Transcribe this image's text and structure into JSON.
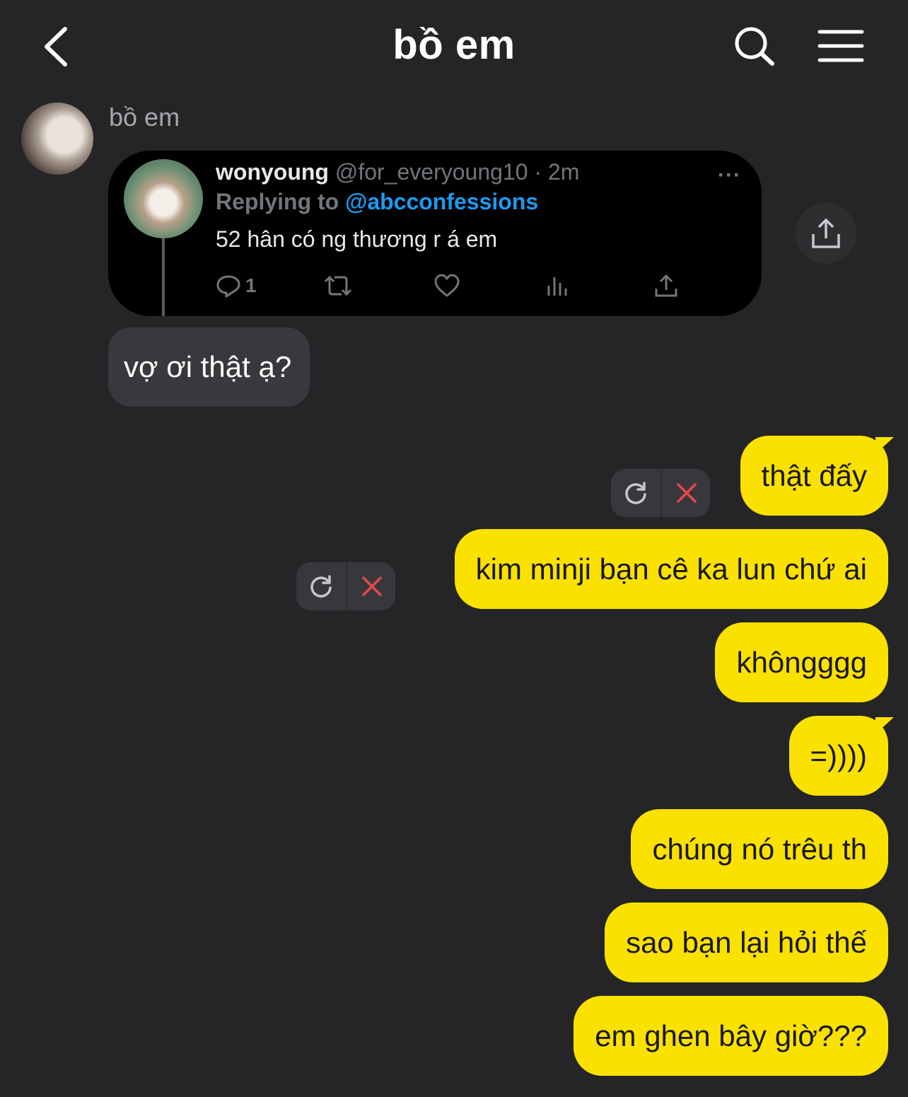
{
  "header": {
    "title": "bồ em",
    "back_icon": "chevron-left-icon",
    "search_icon": "search-icon",
    "menu_icon": "hamburger-menu-icon"
  },
  "incoming": {
    "sender_name": "bồ em",
    "tweet": {
      "display_name": "wonyoung",
      "handle_and_time": "@for_everyoung10 · 2m",
      "replying_label": "Replying to",
      "replying_mention": "@abcconfessions",
      "text": "52 hân có ng thương r á em",
      "more": "···",
      "reply_count": "1"
    },
    "message": "vợ ơi thật ạ?"
  },
  "outgoing": [
    {
      "text": "thật đấy",
      "failed": true
    },
    {
      "text": "kim minji bạn cê ka lun chứ ai",
      "failed": true
    },
    {
      "text": "khôngggg",
      "failed": false
    },
    {
      "text": "=))))",
      "failed": false
    },
    {
      "text": "chúng nó trêu th",
      "failed": false
    },
    {
      "text": "sao bạn lại hỏi thế",
      "failed": false
    },
    {
      "text": "em ghen bây giờ???",
      "failed": false
    }
  ],
  "colors": {
    "background": "#252527",
    "outgoing_bubble": "#fae100",
    "incoming_bubble": "#39393d",
    "mention_blue": "#1d9bf0",
    "failed_x_red": "#e5484d"
  }
}
